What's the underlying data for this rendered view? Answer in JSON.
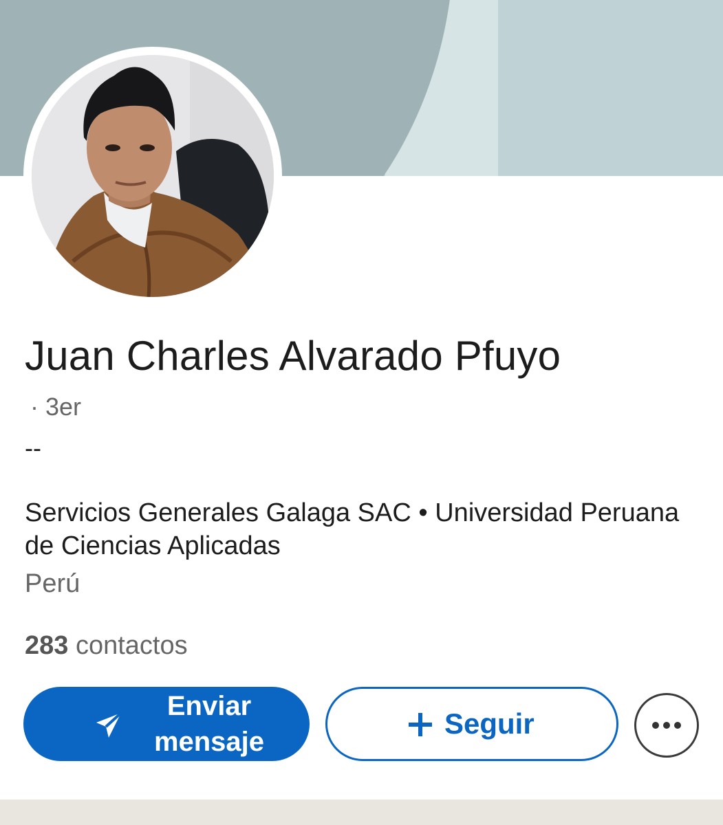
{
  "profile": {
    "name": "Juan Charles Alvarado Pfuyo",
    "degree": "· 3er",
    "headline": "--",
    "company_school": "Servicios Generales Galaga SAC • Universidad Peruana de Ciencias Aplicadas",
    "location": "Perú",
    "connections_count": "283",
    "connections_label": "contactos"
  },
  "actions": {
    "message_label_line1": "Enviar",
    "message_label_line2": "mensaje",
    "message_icon": "send-icon",
    "follow_label": "Seguir",
    "follow_icon": "plus-icon",
    "more_icon": "more-horizontal-icon"
  },
  "colors": {
    "primary": "#0a66c2",
    "banner_light": "#bfd3d6",
    "banner_dark": "#9fb2b6",
    "text_primary": "#1c1c1c",
    "text_secondary": "#666666"
  }
}
